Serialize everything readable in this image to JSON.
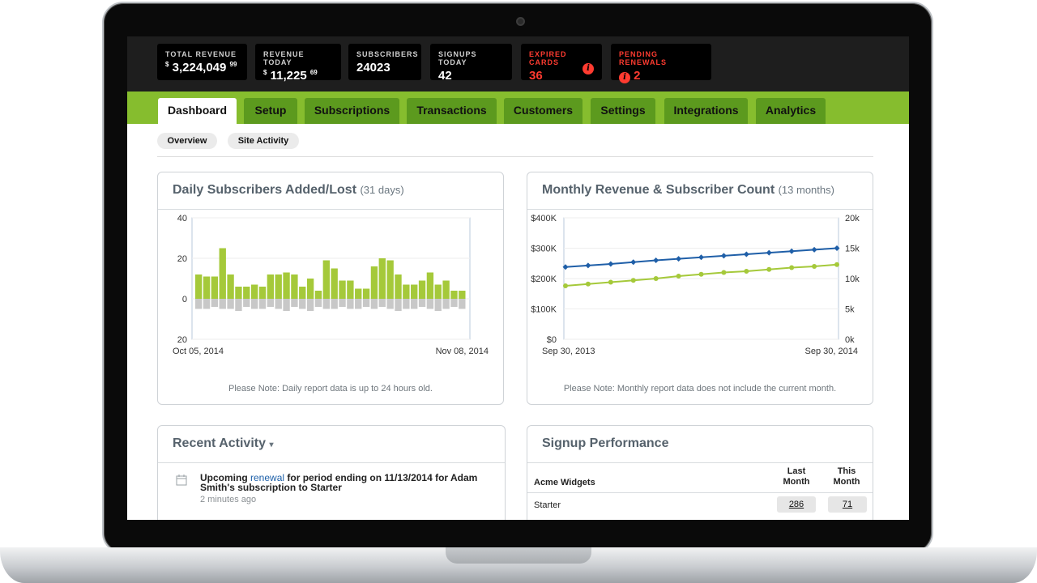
{
  "stats": [
    {
      "label": "TOTAL REVENUE",
      "currency": "$",
      "main": "3,224,049",
      "cents": "99"
    },
    {
      "label": "REVENUE TODAY",
      "currency": "$",
      "main": "11,225",
      "cents": "69"
    },
    {
      "label": "SUBSCRIBERS",
      "value": "24023"
    },
    {
      "label": "SIGNUPS TODAY",
      "value": "42"
    },
    {
      "label": "EXPIRED CARDS",
      "value": "36",
      "icon": "info-icon"
    },
    {
      "label": "PENDING RENEWALS",
      "value": "2",
      "icon": "info-icon"
    }
  ],
  "colors": {
    "accent_green": "#86bd2e",
    "tab_dark": "#5c9a1e",
    "alert_red": "#ff3b30",
    "series_blue": "#1f5fa8",
    "series_green": "#a5c93a",
    "negative_gray": "#c8c8c8"
  },
  "nav": {
    "tabs": [
      "Dashboard",
      "Setup",
      "Subscriptions",
      "Transactions",
      "Customers",
      "Settings",
      "Integrations",
      "Analytics"
    ],
    "active": "Dashboard",
    "subtabs": [
      "Overview",
      "Site Activity"
    ]
  },
  "daily_panel": {
    "title": "Daily Subscribers Added/Lost",
    "subtitle": "(31 days)",
    "note": "Please Note: Daily report data is up to 24 hours old."
  },
  "monthly_panel": {
    "title": "Monthly Revenue & Subscriber Count",
    "subtitle": "(13 months)",
    "note": "Please Note: Monthly report data does not include the current month."
  },
  "activity": {
    "title": "Recent Activity",
    "caret": "▾",
    "item_prefix": "Upcoming",
    "item_link": "renewal",
    "item_suffix": "for period ending on 11/13/2014 for Adam Smith's subscription to Starter",
    "item_time": "2 minutes ago",
    "item_icon": "calendar-icon"
  },
  "signup_perf": {
    "title": "Signup Performance",
    "site": "Acme Widgets",
    "col_last": "Last Month",
    "col_this": "This Month",
    "rows": [
      {
        "plan": "Starter",
        "last": "286",
        "this": "71"
      }
    ]
  },
  "chart_data": [
    {
      "type": "bar",
      "x_start_label": "Oct 05, 2014",
      "x_end_label": "Nov 08, 2014",
      "y_ticks": [
        "40",
        "20",
        "0",
        "20"
      ],
      "ylim": [
        -20,
        40
      ],
      "series": [
        {
          "values": [
            12,
            11,
            11,
            25,
            12,
            6,
            6,
            7,
            6,
            12,
            12,
            13,
            12,
            6,
            10,
            4,
            19,
            15,
            9,
            9,
            5,
            5,
            16,
            20,
            19,
            12,
            7,
            7,
            9,
            13,
            7,
            9,
            4,
            4
          ]
        },
        {
          "values": [
            -5,
            -5,
            -4,
            -5,
            -5,
            -6,
            -4,
            -5,
            -5,
            -4,
            -5,
            -6,
            -4,
            -5,
            -6,
            -4,
            -5,
            -5,
            -4,
            -5,
            -5,
            -4,
            -5,
            -4,
            -5,
            -6,
            -5,
            -5,
            -4,
            -5,
            -6,
            -5,
            -4,
            -5
          ]
        }
      ]
    },
    {
      "type": "line",
      "x_start_label": "Sep 30, 2013",
      "x_end_label": "Sep 30, 2014",
      "y_left_ticks": [
        "$400K",
        "$300K",
        "$200K",
        "$100K",
        "$0"
      ],
      "y_right_ticks": [
        "20k",
        "15k",
        "10k",
        "5k",
        "0k"
      ],
      "ylim_left": [
        0,
        400000
      ],
      "ylim_right": [
        0,
        20000
      ],
      "series": [
        {
          "axis": "left",
          "values": [
            238000,
            243000,
            248000,
            254000,
            260000,
            265000,
            270000,
            275000,
            280000,
            285000,
            290000,
            295000,
            300000
          ]
        },
        {
          "axis": "right",
          "values": [
            8800,
            9100,
            9400,
            9700,
            10000,
            10400,
            10700,
            11000,
            11200,
            11500,
            11800,
            12000,
            12300
          ]
        }
      ]
    }
  ]
}
